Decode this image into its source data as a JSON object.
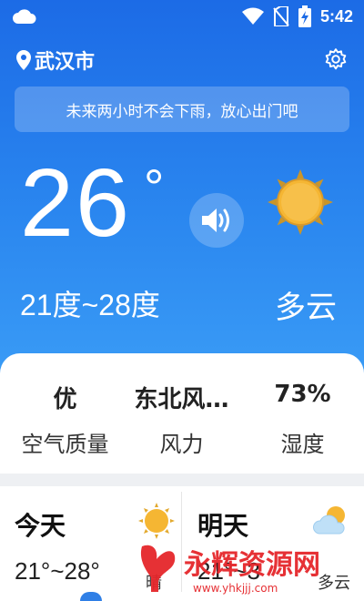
{
  "status_bar": {
    "time": "5:42"
  },
  "header": {
    "city": "武汉市"
  },
  "notice": {
    "text": "未来两小时不会下雨，放心出门吧"
  },
  "current": {
    "temperature": "26",
    "degree_symbol": "°",
    "range": "21度~28度",
    "condition": "多云"
  },
  "stats": [
    {
      "value": "优",
      "label": "空气质量"
    },
    {
      "value": "东北风…",
      "label": "风力"
    },
    {
      "value": "73%",
      "label": "湿度"
    }
  ],
  "forecast": [
    {
      "day": "今天",
      "range": "21°~28°",
      "condition": "晴",
      "icon": "sun-icon"
    },
    {
      "day": "明天",
      "range": "21°~3",
      "condition": "多云",
      "icon": "cloudy-icon"
    }
  ],
  "watermark": {
    "brand": "永辉资源网",
    "url": "www.yhkjjj.com"
  },
  "colors": {
    "hero_top": "#1c6be6",
    "hero_bottom": "#3a9cf6",
    "sun": "#f5b633",
    "watermark_red": "#e5262b"
  }
}
